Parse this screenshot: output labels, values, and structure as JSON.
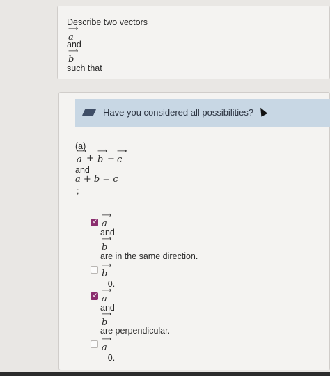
{
  "intro": {
    "line1": "Describe two vectors",
    "vec_a": "a",
    "and": "and",
    "vec_b": "b",
    "such_that": "such that"
  },
  "tip": {
    "icon": "eraser-icon",
    "text": "Have you considered all possibilities?"
  },
  "part": {
    "label": "(a)",
    "eq_a": "a",
    "eq_plus": "+",
    "eq_b": "b",
    "eq_equals": "=",
    "eq_c": "c",
    "and": "and",
    "scalar_eq": "a + b = c",
    "semicolon": ";"
  },
  "options": [
    {
      "checked": true,
      "vec1": "a",
      "mid": "and",
      "vec2": "b",
      "text": "are in the same direction."
    },
    {
      "checked": false,
      "vec1": "b",
      "text": "= 0."
    },
    {
      "checked": true,
      "vec1": "a",
      "mid": "and",
      "vec2": "b",
      "text": "are perpendicular."
    },
    {
      "checked": false,
      "vec1": "a",
      "text": "= 0."
    }
  ],
  "colors": {
    "checkbox_checked": "#8a2d6e",
    "tip_background": "#c8d7e4",
    "tip_icon": "#3f4e66"
  }
}
